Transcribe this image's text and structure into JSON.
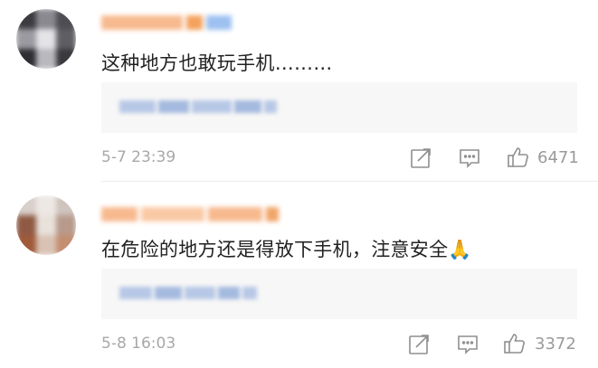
{
  "comments": [
    {
      "text": "这种地方也敢玩手机………",
      "time": "5-7 23:39",
      "likes": "6471"
    },
    {
      "text": "在危险的地方还是得放下手机，注意安全🙏",
      "time": "5-8 16:03",
      "likes": "3372"
    }
  ],
  "icons": {
    "share": "share-icon",
    "comment": "comment-icon",
    "like": "like-icon"
  },
  "colors": {
    "name_blur": "#f6b98a",
    "reply_blur": "#9fb8dc",
    "meta_gray": "#a8a8a8"
  }
}
